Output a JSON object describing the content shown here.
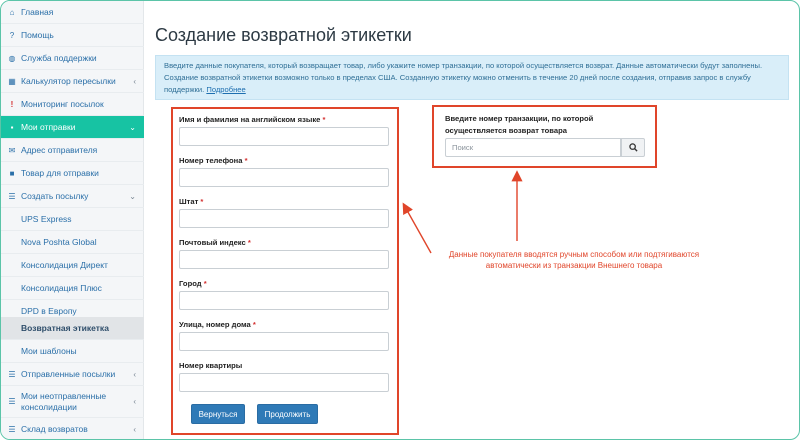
{
  "sidebar": {
    "items": [
      {
        "label": "Главная",
        "icon": "home-icon"
      },
      {
        "label": "Помощь",
        "icon": "help-icon"
      },
      {
        "label": "Служба поддержки",
        "icon": "globe-icon"
      },
      {
        "label": "Калькулятор пересылки",
        "icon": "calculator-icon"
      },
      {
        "label": "Мониторинг посылок",
        "icon": "exclamation-icon"
      },
      {
        "label": "Мои отправки",
        "icon": "briefcase-icon"
      },
      {
        "label": "Адрес отправителя",
        "icon": "envelope-icon"
      },
      {
        "label": "Товар для отправки",
        "icon": "box-icon"
      },
      {
        "label": "Создать посылку",
        "icon": "list-icon"
      },
      {
        "label": "UPS Express"
      },
      {
        "label": "Nova Poshta Global"
      },
      {
        "label": "Консолидация Директ"
      },
      {
        "label": "Консолидация Плюс"
      },
      {
        "label": "DPD в Европу"
      },
      {
        "label": "Возвратная этикетка"
      },
      {
        "label": "Мои шаблоны"
      },
      {
        "label": "Отправленные посылки",
        "icon": "list-icon"
      },
      {
        "label": "Мои неотправленные консолидации",
        "icon": "list-icon"
      },
      {
        "label": "Склад возвратов",
        "icon": "list-icon"
      }
    ]
  },
  "page": {
    "title": "Создание возвратной этикетки",
    "info_text": "Введите данные покупателя, который возвращает товар, либо укажите номер транзакции, по которой осуществляется возврат. Данные автоматически будут заполнены. Создание возвратной этикетки возможно только в пределах США. Созданную этикетку можно отменить в течение 20 дней после создания, отправив запрос в службу поддержки.",
    "info_link": "Подробнее"
  },
  "form": {
    "fields": [
      {
        "label": "Имя и фамилия на английском языке",
        "required": "*",
        "value": ""
      },
      {
        "label": "Номер телефона",
        "required": "*",
        "value": ""
      },
      {
        "label": "Штат",
        "required": "*",
        "value": ""
      },
      {
        "label": "Почтовый индекс",
        "required": "*",
        "value": ""
      },
      {
        "label": "Город",
        "required": "*",
        "value": ""
      },
      {
        "label": "Улица, номер дома",
        "required": "*",
        "value": ""
      },
      {
        "label": "Номер квартиры",
        "required": "",
        "value": ""
      }
    ],
    "back_button": "Вернуться",
    "continue_button": "Продолжить"
  },
  "transaction": {
    "label": "Введите номер транзакции, по которой осуществляется возврат товара",
    "placeholder": "Поиск"
  },
  "annotation": {
    "text": "Данные покупателя вводятся ручным способом или подтягиваются автоматически из транзакции Внешнего товара"
  },
  "colors": {
    "accent": "#17c3a3",
    "primary_button": "#2f7ab7",
    "annotation_red": "#e0452a"
  }
}
